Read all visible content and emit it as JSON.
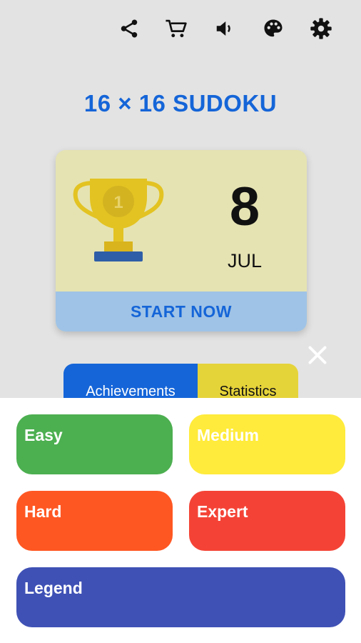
{
  "toolbar": {
    "icons": [
      "share-icon",
      "cart-icon",
      "volume-icon",
      "palette-icon",
      "gear-icon"
    ]
  },
  "app": {
    "title": "16 × 16 SUDOKU"
  },
  "daily": {
    "trophy_rank": "1",
    "day": "8",
    "month": "JUL",
    "start_label": "START NOW"
  },
  "tabs": {
    "achievements": "Achievements",
    "statistics": "Statistics"
  },
  "levels": {
    "easy": "Easy",
    "medium": "Medium",
    "hard": "Hard",
    "expert": "Expert",
    "legend": "Legend"
  },
  "colors": {
    "title": "#1565d8",
    "card_bg": "#e5e3b2",
    "start_bar": "#9fc3e6",
    "easy": "#4caf50",
    "medium": "#ffeb3b",
    "hard": "#ff5722",
    "expert": "#f44336",
    "legend": "#3f51b5"
  }
}
